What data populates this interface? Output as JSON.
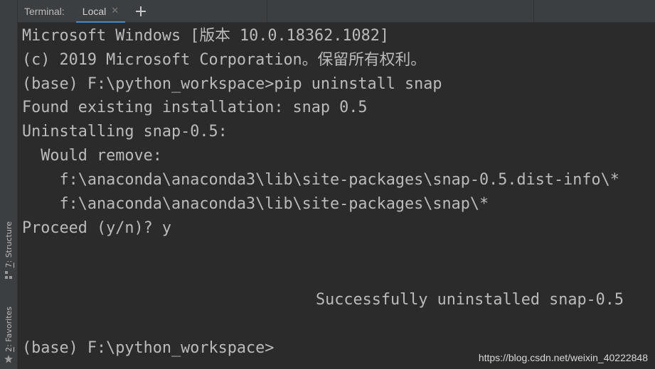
{
  "sidebar": {
    "structure_key": "7",
    "structure_label": ": Structure",
    "favorites_key": "2",
    "favorites_label": ": Favorites"
  },
  "tabbar": {
    "title": "Terminal:",
    "tabs": [
      {
        "label": "Local",
        "active": true
      }
    ]
  },
  "terminal": {
    "lines": [
      "Microsoft Windows [版本 10.0.18362.1082]",
      "(c) 2019 Microsoft Corporation。保留所有权利。",
      "(base) F:\\python_workspace>pip uninstall snap",
      "Found existing installation: snap 0.5",
      "Uninstalling snap-0.5:",
      "  Would remove:",
      "    f:\\anaconda\\anaconda3\\lib\\site-packages\\snap-0.5.dist-info\\*",
      "    f:\\anaconda\\anaconda3\\lib\\site-packages\\snap\\*",
      "Proceed (y/n)? y",
      "Successfully uninstalled snap-0.5",
      "(base) F:\\python_workspace>"
    ]
  },
  "watermark": "https://blog.csdn.net/weixin_40222848",
  "colors": {
    "terminal_bg": "#2b2b2b",
    "terminal_text": "#bbbbbb",
    "panel_bg": "#3c3f41",
    "active_tab_underline": "#4a88c7"
  }
}
